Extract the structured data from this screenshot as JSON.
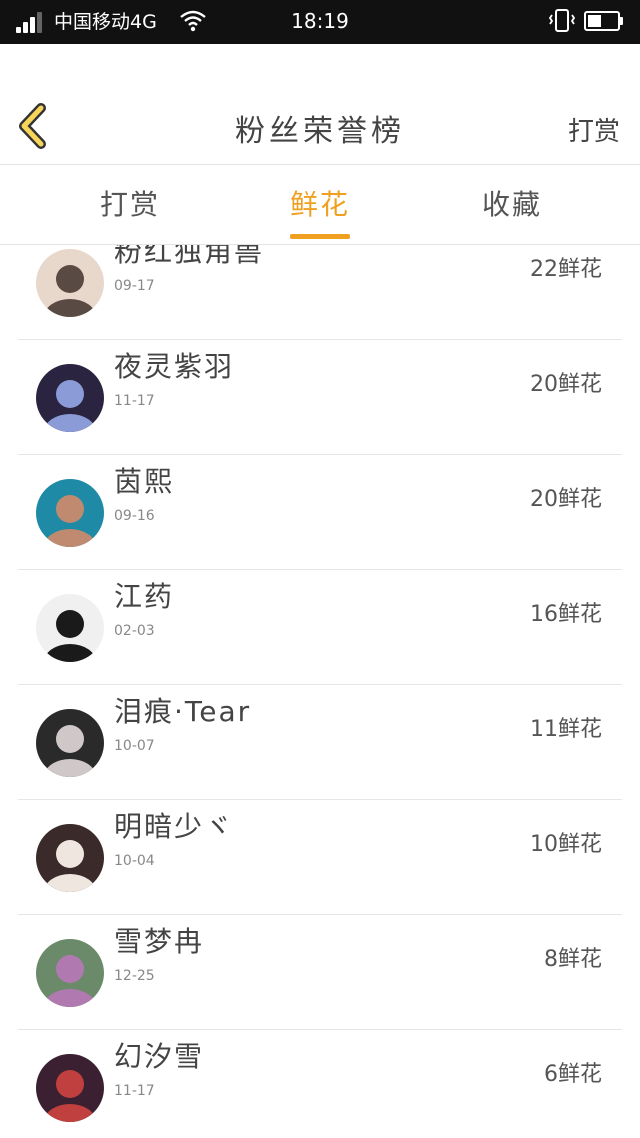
{
  "status_bar": {
    "carrier": "中国移动4G",
    "time": "18:19",
    "signal_bars": 3,
    "battery_level": 0.45,
    "icons": [
      "signal-icon",
      "wifi-icon",
      "vibrate-icon",
      "battery-icon"
    ]
  },
  "header": {
    "back_icon": "chevron-left-icon",
    "title": "粉丝荣誉榜",
    "right_action": "打赏"
  },
  "tabs": [
    {
      "label": "打赏",
      "active": false
    },
    {
      "label": "鲜花",
      "active": true
    },
    {
      "label": "收藏",
      "active": false
    }
  ],
  "colors": {
    "accent": "#f0a020",
    "back_icon_fill": "#f7d55a"
  },
  "fans": [
    {
      "name": "粉红独角兽",
      "date": "09-17",
      "count": "22鲜花",
      "avatar_colors": [
        "#e8d8cc",
        "#5a4a44"
      ]
    },
    {
      "name": "夜灵紫羽",
      "date": "11-17",
      "count": "20鲜花",
      "avatar_colors": [
        "#2a2440",
        "#8a9bd8"
      ]
    },
    {
      "name": "茵熙",
      "date": "09-16",
      "count": "20鲜花",
      "avatar_colors": [
        "#1e8aa6",
        "#c08a70"
      ]
    },
    {
      "name": "江药",
      "date": "02-03",
      "count": "16鲜花",
      "avatar_colors": [
        "#f0f0f0",
        "#1a1a1a"
      ]
    },
    {
      "name": "泪痕·Tear",
      "date": "10-07",
      "count": "11鲜花",
      "avatar_colors": [
        "#2a2a2a",
        "#d0c8c8"
      ]
    },
    {
      "name": "明暗少ヾ",
      "date": "10-04",
      "count": "10鲜花",
      "avatar_colors": [
        "#3a2a2a",
        "#f0e6e0"
      ]
    },
    {
      "name": "雪梦冉",
      "date": "12-25",
      "count": "8鲜花",
      "avatar_colors": [
        "#6a8a6a",
        "#b07ab0"
      ]
    },
    {
      "name": "幻汐雪",
      "date": "11-17",
      "count": "6鲜花",
      "avatar_colors": [
        "#3a2030",
        "#c04040"
      ]
    }
  ]
}
